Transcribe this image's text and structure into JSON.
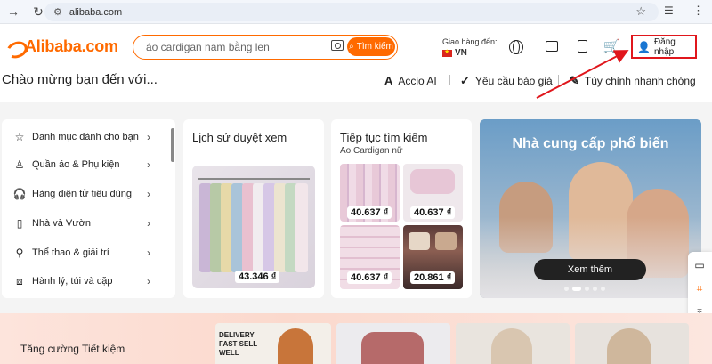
{
  "browser": {
    "url": "alibaba.com"
  },
  "header": {
    "logo_text": "Alibaba.com",
    "search_placeholder": "áo cardigan nam bằng len",
    "search_button": "Tìm kiếm",
    "deliver_label": "Giao hàng đến:",
    "deliver_country": "VN",
    "login_label": "Đăng nhập"
  },
  "subheader": {
    "welcome": "Chào mừng bạn đến với...",
    "links": [
      {
        "label": "Accio AI",
        "icon": "accio-logo-icon"
      },
      {
        "label": "Yêu cầu báo giá",
        "icon": "rfq-check-icon"
      },
      {
        "label": "Tùy chỉnh nhanh chóng",
        "icon": "magic-wand-icon"
      }
    ]
  },
  "categories": [
    {
      "label": "Danh mục dành cho bạn",
      "icon": "star-icon"
    },
    {
      "label": "Quần áo & Phụ kiện",
      "icon": "dress-icon"
    },
    {
      "label": "Hàng điện tử tiêu dùng",
      "icon": "headphones-icon"
    },
    {
      "label": "Nhà và Vườn",
      "icon": "cabinet-icon"
    },
    {
      "label": "Thể thao & giải trí",
      "icon": "racket-icon"
    },
    {
      "label": "Hành lý, túi và cặp",
      "icon": "luggage-icon"
    }
  ],
  "history_card": {
    "title": "Lịch sử duyệt xem",
    "price": "43.346 ₫"
  },
  "continue_card": {
    "title": "Tiếp tục tìm kiếm",
    "subtitle": "Ao Cardigan nữ",
    "prices": [
      "40.637 ₫",
      "40.637 ₫",
      "40.637 ₫",
      "20.861 ₫"
    ]
  },
  "hero": {
    "title": "Nhà cung cấp phổ biến",
    "button": "Xem thêm",
    "slide_index": 1,
    "slide_count": 5
  },
  "savings": {
    "label": "Tăng cường Tiết kiệm",
    "promo_text": "DELIVERY FAST SELL WELL"
  },
  "colors": {
    "brand": "#ff6a00",
    "highlight": "#e0161c"
  }
}
